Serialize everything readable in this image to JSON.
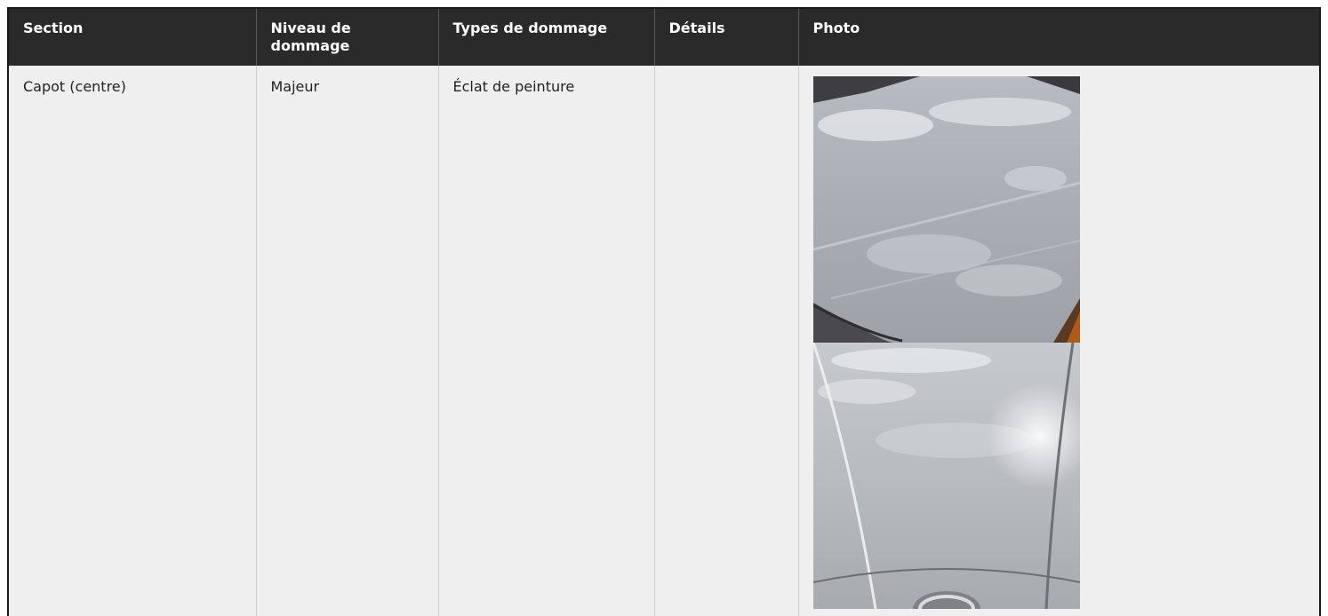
{
  "table": {
    "headers": {
      "section": "Section",
      "level": "Niveau de dommage",
      "types": "Types de dommage",
      "details": "Détails",
      "photo": "Photo"
    },
    "rows": [
      {
        "section": "Capot (centre)",
        "level": "Majeur",
        "types": "Éclat de peinture",
        "details": ""
      }
    ]
  },
  "colors": {
    "header_bg": "#2a2a2a",
    "header_text": "#ffffff",
    "row_bg": "#efefef",
    "border": "#1a1a1a"
  }
}
